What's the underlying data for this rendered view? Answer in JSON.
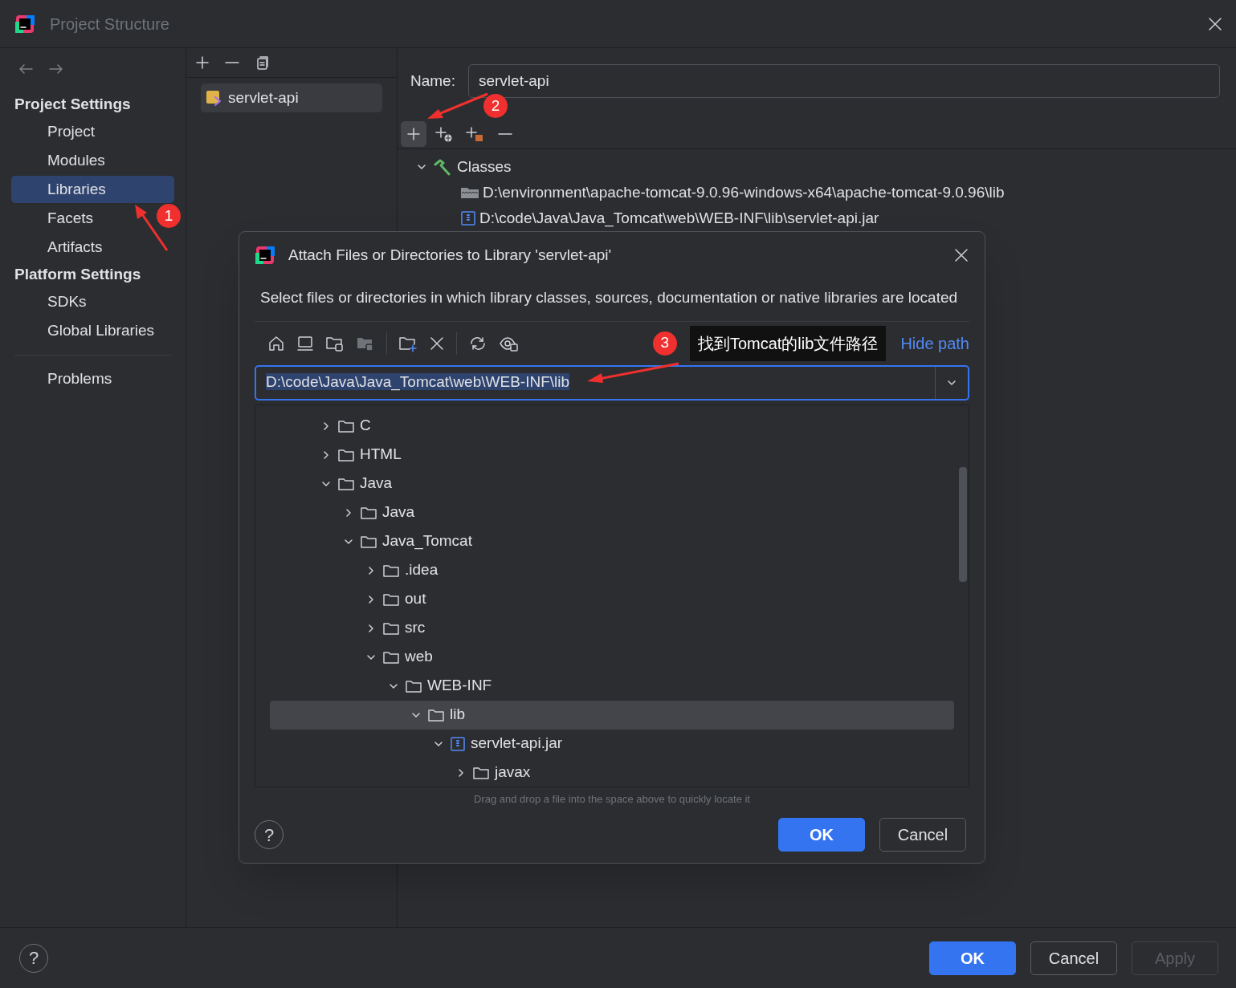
{
  "window": {
    "title": "Project Structure"
  },
  "sidebar": {
    "sections": [
      {
        "heading": "Project Settings",
        "items": [
          {
            "label": "Project",
            "selected": false
          },
          {
            "label": "Modules",
            "selected": false
          },
          {
            "label": "Libraries",
            "selected": true
          },
          {
            "label": "Facets",
            "selected": false
          },
          {
            "label": "Artifacts",
            "selected": false
          }
        ]
      },
      {
        "heading": "Platform Settings",
        "items": [
          {
            "label": "SDKs",
            "selected": false
          },
          {
            "label": "Global Libraries",
            "selected": false
          }
        ]
      }
    ],
    "footer_items": [
      {
        "label": "Problems",
        "selected": false
      }
    ]
  },
  "libraries": {
    "toolbar": [
      {
        "kind": "add"
      },
      {
        "kind": "remove"
      },
      {
        "kind": "copy"
      }
    ],
    "items": [
      {
        "label": "servlet-api",
        "selected": true
      }
    ]
  },
  "library_editor": {
    "name_label": "Name:",
    "name_value": "servlet-api",
    "toolbar": [
      {
        "kind": "add",
        "pressed": true
      },
      {
        "kind": "add-url",
        "pressed": false
      },
      {
        "kind": "add-folder",
        "pressed": false
      },
      {
        "kind": "remove",
        "pressed": false
      }
    ],
    "roots": [
      {
        "label": "Classes",
        "expanded": true,
        "children": [
          {
            "kind": "folder",
            "label": "D:\\environment\\apache-tomcat-9.0.96-windows-x64\\apache-tomcat-9.0.96\\lib"
          },
          {
            "kind": "jar",
            "label": "D:\\code\\Java\\Java_Tomcat\\web\\WEB-INF\\lib\\servlet-api.jar"
          }
        ]
      }
    ]
  },
  "dialog": {
    "title": "Attach Files or Directories to Library 'servlet-api'",
    "description": "Select files or directories in which library classes, sources, documentation or native libraries are located",
    "toolbar": [
      {
        "kind": "home"
      },
      {
        "kind": "desktop"
      },
      {
        "kind": "project"
      },
      {
        "kind": "module"
      },
      {
        "kind": "new-folder"
      },
      {
        "kind": "delete"
      },
      {
        "kind": "refresh"
      },
      {
        "kind": "show-hidden"
      }
    ],
    "help_label": "?",
    "hide_path_link": "Hide path",
    "path": "D:\\code\\Java\\Java_Tomcat\\web\\WEB-INF\\lib",
    "tree": [
      {
        "kind": "folder",
        "label": "C",
        "expanded": false,
        "selected": false
      },
      {
        "kind": "folder",
        "label": "HTML",
        "expanded": false,
        "selected": false
      },
      {
        "kind": "folder",
        "label": "Java",
        "expanded": true,
        "selected": false,
        "children": [
          {
            "kind": "folder",
            "label": "Java",
            "expanded": false,
            "selected": false
          },
          {
            "kind": "folder",
            "label": "Java_Tomcat",
            "expanded": true,
            "selected": false,
            "children": [
              {
                "kind": "folder",
                "label": ".idea",
                "expanded": false,
                "selected": false
              },
              {
                "kind": "folder",
                "label": "out",
                "expanded": false,
                "selected": false
              },
              {
                "kind": "folder",
                "label": "src",
                "expanded": false,
                "selected": false
              },
              {
                "kind": "folder",
                "label": "web",
                "expanded": true,
                "selected": false,
                "children": [
                  {
                    "kind": "folder",
                    "label": "WEB-INF",
                    "expanded": true,
                    "selected": false,
                    "children": [
                      {
                        "kind": "folder",
                        "label": "lib",
                        "expanded": true,
                        "selected": true,
                        "children": [
                          {
                            "kind": "jar",
                            "label": "servlet-api.jar",
                            "expanded": true,
                            "selected": false,
                            "children": [
                              {
                                "kind": "folder",
                                "label": "javax",
                                "expanded": false,
                                "selected": false
                              }
                            ]
                          }
                        ]
                      }
                    ]
                  }
                ]
              }
            ]
          }
        ]
      }
    ],
    "hint": "Drag and drop a file into the space above to quickly locate it",
    "buttons": [
      {
        "label": "OK",
        "kind": "primary"
      },
      {
        "label": "Cancel",
        "kind": "secondary"
      }
    ]
  },
  "help_label": "?",
  "annotations": [
    {
      "label": "1"
    },
    {
      "label": "2"
    },
    {
      "label": "3",
      "note": "找到Tomcat的lib文件路径"
    }
  ],
  "buttons": [
    {
      "label": "OK",
      "kind": "primary",
      "disabled": false
    },
    {
      "label": "Cancel",
      "kind": "secondary",
      "disabled": false
    },
    {
      "label": "Apply",
      "kind": "secondary",
      "disabled": true
    }
  ]
}
